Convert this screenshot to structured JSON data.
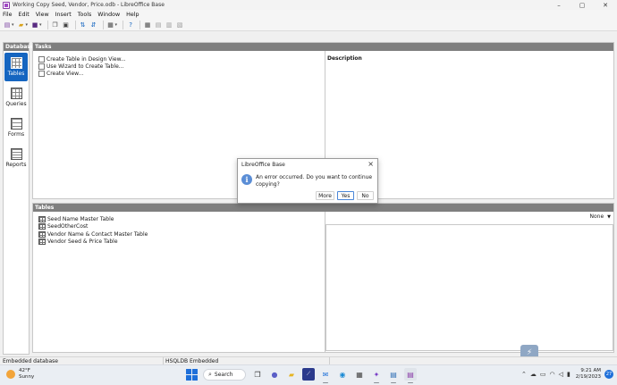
{
  "window": {
    "title": "Working Copy Seed, Vendor, Price.odb - LibreOffice Base",
    "controls": {
      "minimize": "–",
      "maximize": "▢",
      "close": "✕"
    }
  },
  "menubar": {
    "items": [
      "File",
      "Edit",
      "View",
      "Insert",
      "Tools",
      "Window",
      "Help"
    ]
  },
  "toolbar": {
    "icons": [
      "new-icon",
      "open-icon",
      "save-icon",
      "copy-icon",
      "paste-icon",
      "sort-ascending-icon",
      "sort-descending-icon",
      "form-icon",
      "help-icon",
      "table-icon",
      "query-icon",
      "form-view-icon",
      "report-icon"
    ]
  },
  "database_panel": {
    "header": "Database",
    "items": [
      {
        "label": "Tables",
        "active": true
      },
      {
        "label": "Queries",
        "active": false
      },
      {
        "label": "Forms",
        "active": false
      },
      {
        "label": "Reports",
        "active": false
      }
    ]
  },
  "tasks_panel": {
    "header": "Tasks",
    "items": [
      "Create Table in Design View...",
      "Use Wizard to Create Table...",
      "Create View..."
    ],
    "description_header": "Description"
  },
  "tables_panel": {
    "header": "Tables",
    "items": [
      "Seed Name Master Table",
      "SeedOtherCost",
      "Vendor Name & Contact Master Table",
      "Vendor Seed & Price Table"
    ],
    "preview_option": "None"
  },
  "dialog": {
    "title": "LibreOffice Base",
    "message": "An error occurred. Do you want to continue copying?",
    "buttons": {
      "more": "More",
      "yes": "Yes",
      "no": "No"
    },
    "info_glyph": "i"
  },
  "statusbar": {
    "left": "Embedded database",
    "middle": "HSQLDB Embedded"
  },
  "taskbar": {
    "weather_temp": "42°F",
    "weather_cond": "Sunny",
    "search_label": "Search",
    "time": "9:21 AM",
    "date": "2/19/2023",
    "notifications": "27"
  },
  "colors": {
    "accent": "#1565c0",
    "panel_header": "#7f7f7f",
    "info_icon": "#5b8ed6"
  }
}
